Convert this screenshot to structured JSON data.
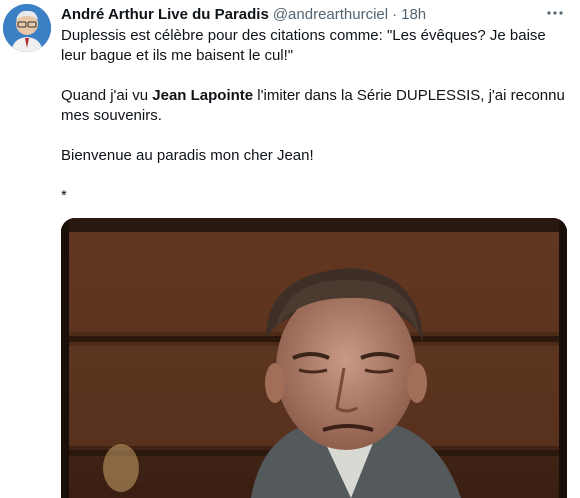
{
  "author": {
    "display_name": "André Arthur Live du Paradis",
    "handle": "@andrearthurciel",
    "separator": "·",
    "time": "18h"
  },
  "tweet": {
    "line1": "Duplessis est célèbre pour des citations comme: \"Les évêques? Je baise leur bague et ils me baisent le cul!\"",
    "p2_before": "Quand j'ai vu ",
    "p2_bold": "Jean Lapointe",
    "p2_after": " l'imiter dans la Série DUPLESSIS, j'ai reconnu mes souvenirs.",
    "p3": "Bienvenue au paradis mon cher Jean!",
    "p4": "*"
  },
  "icons": {
    "more": "more-horizontal-icon",
    "avatar": "profile-photo"
  },
  "colors": {
    "text": "#0f1419",
    "secondary": "#536471",
    "background": "#ffffff"
  }
}
